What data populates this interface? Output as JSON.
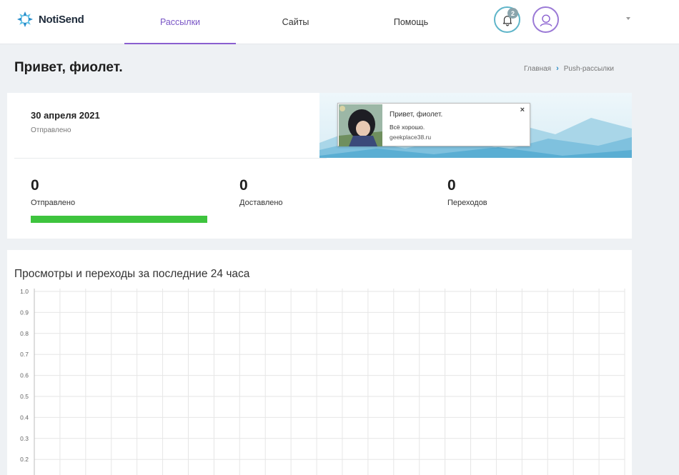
{
  "header": {
    "logo_text": "NotiSend",
    "nav": [
      {
        "label": "Рассылки",
        "active": true
      },
      {
        "label": "Сайты",
        "active": false
      },
      {
        "label": "Помощь",
        "active": false
      }
    ],
    "notifications_count": "2",
    "accent_color": "#8a5fd0"
  },
  "page": {
    "title": "Привет, фиолет.",
    "breadcrumb": [
      "Главная",
      "Push-рассылки"
    ]
  },
  "mailing": {
    "date": "30 апреля 2021",
    "status": "Отправлено",
    "preview": {
      "title": "Привет, фиолет.",
      "body": "Всё хорошо.",
      "site": "geekplace38.ru"
    },
    "stats": [
      {
        "value": "0",
        "label": "Отправлено",
        "progress": 1.0
      },
      {
        "value": "0",
        "label": "Доставлено"
      },
      {
        "value": "0",
        "label": "Переходов"
      }
    ],
    "progress_color": "#3ec43e"
  },
  "chart_data": {
    "type": "line",
    "title": "Просмотры и переходы за последние 24 часа",
    "xlabel": "",
    "ylabel": "",
    "ylim": [
      0,
      1.0
    ],
    "y_ticks": [
      "1.0",
      "0.9",
      "0.8",
      "0.7",
      "0.6",
      "0.5",
      "0.4",
      "0.3",
      "0.2"
    ],
    "grid": true,
    "series": []
  }
}
